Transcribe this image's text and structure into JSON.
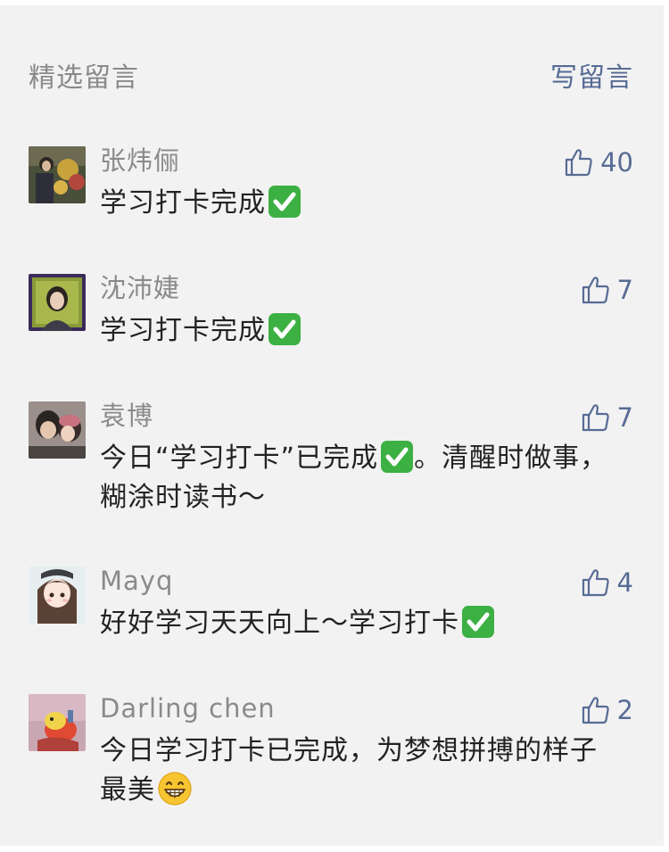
{
  "header": {
    "title": "精选留言",
    "write_label": "写留言"
  },
  "colors": {
    "panel_bg": "#f2f2f2",
    "link": "#576b95",
    "muted": "#8a8a8a",
    "text": "#222222",
    "check_green": "#3cb043"
  },
  "icons": {
    "like": "thumbs-up-icon",
    "check": "white-check-mark-emoji",
    "grin": "grinning-face-emoji"
  },
  "comments": [
    {
      "nickname": "张炜俪",
      "likes": "40",
      "text": "学习打卡完成"
    },
    {
      "nickname": "沈沛婕",
      "likes": "7",
      "text": "学习打卡完成"
    },
    {
      "nickname": "袁博",
      "likes": "7",
      "text_before": "今日“学习打卡”已完成",
      "text_after": "。清醒时做事，糊涂时读书～"
    },
    {
      "nickname": "Mayq",
      "likes": "4",
      "text": "好好学习天天向上～学习打卡"
    },
    {
      "nickname": "Darling chen",
      "likes": "2",
      "text": "今日学习打卡已完成，为梦想拼搏的样子最美"
    }
  ]
}
